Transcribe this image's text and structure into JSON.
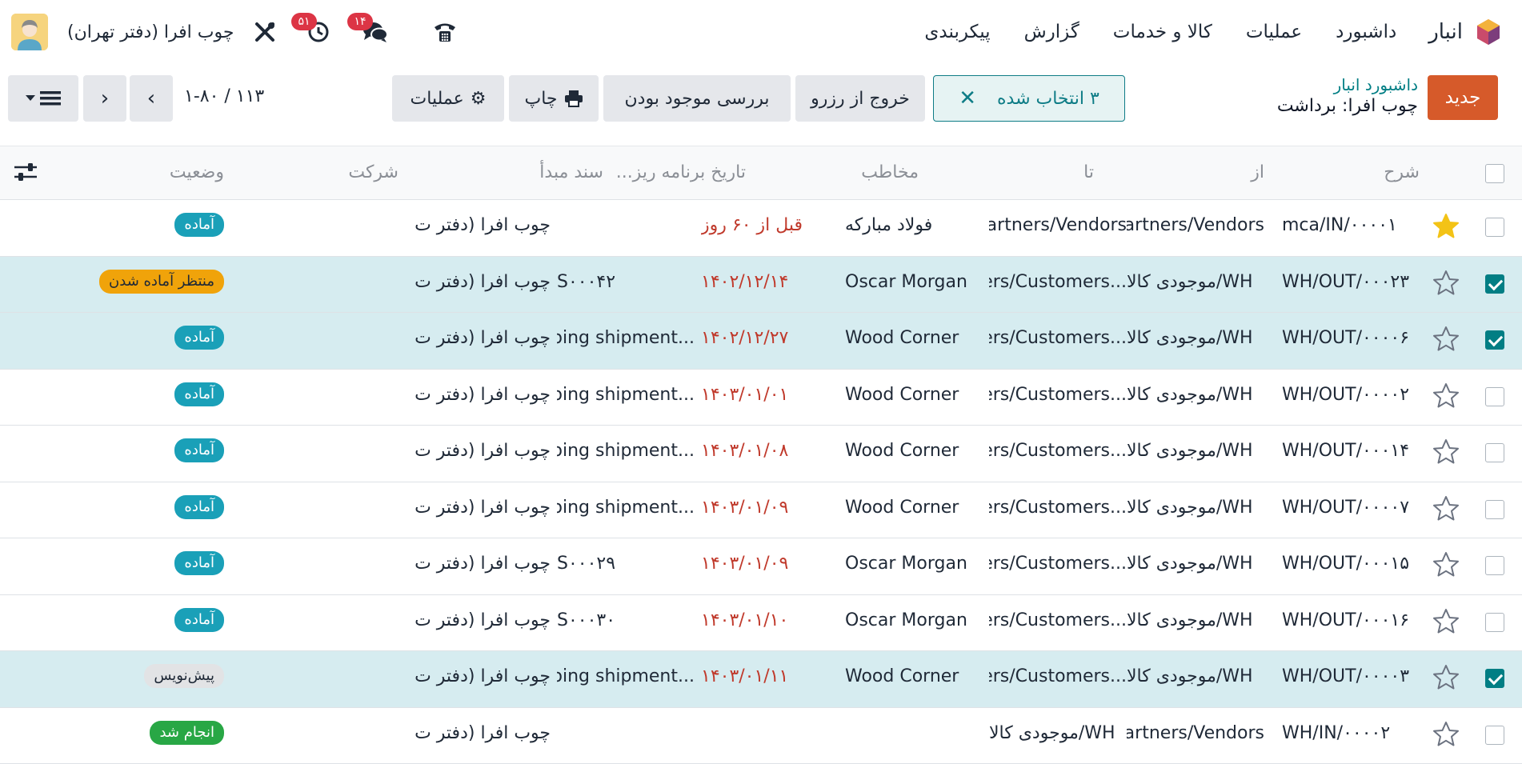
{
  "navbar": {
    "app_name": "انبار",
    "menu": [
      "داشبورد",
      "عملیات",
      "کالا و خدمات",
      "گزارش",
      "پیکربندی"
    ],
    "company": "چوب افرا (دفتر تهران)",
    "activity_count": "۵۱",
    "messages_count": "۱۴"
  },
  "control": {
    "new_label": "جدید",
    "breadcrumb_parent": "داشبورد انبار",
    "breadcrumb_current": "چوب افرا: برداشت",
    "selected_label": "۳ انتخاب شده",
    "unreserve_label": "خروج از رزرو",
    "check_availability_label": "بررسی موجود بودن",
    "print_label": "چاپ",
    "actions_label": "عملیات",
    "pager": "۱-۸۰ / ۱۱۳"
  },
  "table": {
    "headers": {
      "reference": "شرح",
      "from": "از",
      "to": "تا",
      "contact": "مخاطب",
      "scheduled": "تاریخ برنامه ریز...",
      "source": "سند مبدأ",
      "company": "شرکت",
      "status": "وضعیت"
    },
    "rows": [
      {
        "selected": false,
        "starred": true,
        "reference": "mca/IN/۰۰۰۰۱",
        "from": "Partners/Vendors",
        "to": "Partners/Vendors",
        "contact": "فولاد مبارکه",
        "scheduled": "قبل از ۶۰ روز",
        "source": "",
        "company": "چوب افرا (دفتر ت...",
        "status": "آماده",
        "status_kind": "ready"
      },
      {
        "selected": true,
        "starred": false,
        "reference": "WH/OUT/۰۰۰۲۳",
        "from": "WH/موجودی کالا",
        "to": "...ners/Customers",
        "contact": "Oscar Morgan",
        "scheduled": "۱۴۰۲/۱۲/۱۴",
        "source": "S۰۰۰۴۲",
        "company": "چوب افرا (دفتر ت...",
        "status": "منتظر آماده شدن",
        "status_kind": "wait"
      },
      {
        "selected": true,
        "starred": false,
        "reference": "WH/OUT/۰۰۰۰۶",
        "from": "WH/موجودی کالا",
        "to": "...ners/Customers",
        "contact": "Wood Corner",
        "scheduled": "۱۴۰۲/۱۲/۲۷",
        "source": "...tgoing shipment",
        "company": "چوب افرا (دفتر ت...",
        "status": "آماده",
        "status_kind": "ready"
      },
      {
        "selected": false,
        "starred": false,
        "reference": "WH/OUT/۰۰۰۰۲",
        "from": "WH/موجودی کالا",
        "to": "...ners/Customers",
        "contact": "Wood Corner",
        "scheduled": "۱۴۰۳/۰۱/۰۱",
        "source": "...tgoing shipment",
        "company": "چوب افرا (دفتر ت...",
        "status": "آماده",
        "status_kind": "ready"
      },
      {
        "selected": false,
        "starred": false,
        "reference": "WH/OUT/۰۰۰۱۴",
        "from": "WH/موجودی کالا",
        "to": "...ners/Customers",
        "contact": "Wood Corner",
        "scheduled": "۱۴۰۳/۰۱/۰۸",
        "source": "...tgoing shipment",
        "company": "چوب افرا (دفتر ت...",
        "status": "آماده",
        "status_kind": "ready"
      },
      {
        "selected": false,
        "starred": false,
        "reference": "WH/OUT/۰۰۰۰۷",
        "from": "WH/موجودی کالا",
        "to": "...ners/Customers",
        "contact": "Wood Corner",
        "scheduled": "۱۴۰۳/۰۱/۰۹",
        "source": "...tgoing shipment",
        "company": "چوب افرا (دفتر ت...",
        "status": "آماده",
        "status_kind": "ready"
      },
      {
        "selected": false,
        "starred": false,
        "reference": "WH/OUT/۰۰۰۱۵",
        "from": "WH/موجودی کالا",
        "to": "...ners/Customers",
        "contact": "Oscar Morgan",
        "scheduled": "۱۴۰۳/۰۱/۰۹",
        "source": "S۰۰۰۲۹",
        "company": "چوب افرا (دفتر ت...",
        "status": "آماده",
        "status_kind": "ready"
      },
      {
        "selected": false,
        "starred": false,
        "reference": "WH/OUT/۰۰۰۱۶",
        "from": "WH/موجودی کالا",
        "to": "...ners/Customers",
        "contact": "Oscar Morgan",
        "scheduled": "۱۴۰۳/۰۱/۱۰",
        "source": "S۰۰۰۳۰",
        "company": "چوب افرا (دفتر ت...",
        "status": "آماده",
        "status_kind": "ready"
      },
      {
        "selected": true,
        "starred": false,
        "reference": "WH/OUT/۰۰۰۰۳",
        "from": "WH/موجودی کالا",
        "to": "...ners/Customers",
        "contact": "Wood Corner",
        "scheduled": "۱۴۰۳/۰۱/۱۱",
        "source": "...tgoing shipment",
        "company": "چوب افرا (دفتر ت...",
        "status": "پیش‌نویس",
        "status_kind": "draft"
      },
      {
        "selected": false,
        "starred": false,
        "reference": "WH/IN/۰۰۰۰۲",
        "from": "Partners/Vendors",
        "to": "WH/موجودی کالا",
        "contact": "",
        "scheduled": "",
        "source": "",
        "company": "چوب افرا (دفتر ت...",
        "status": "انجام شد",
        "status_kind": "done"
      }
    ]
  }
}
